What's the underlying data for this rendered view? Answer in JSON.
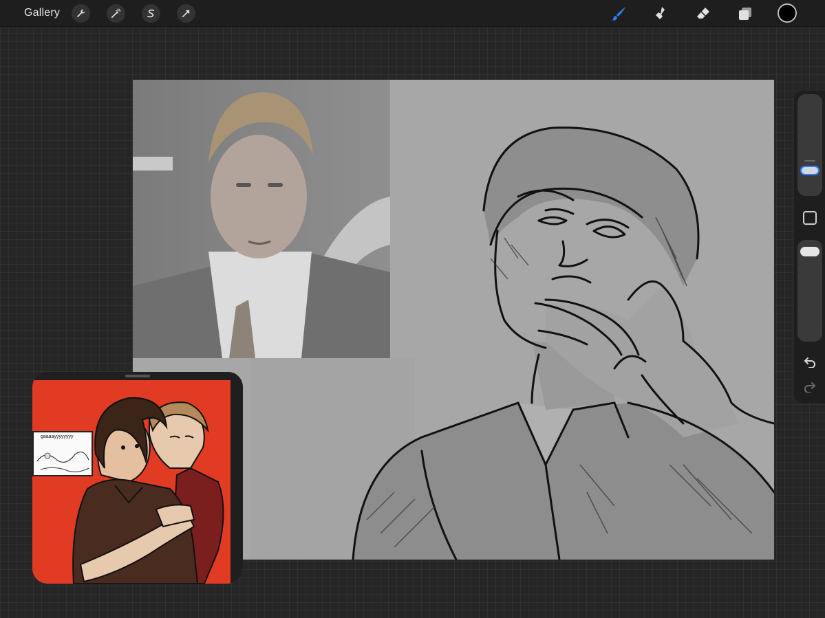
{
  "toolbar": {
    "gallery_label": "Gallery",
    "left_tools": [
      "wrench-icon",
      "magic-wand-icon",
      "selection-s-icon",
      "move-arrow-icon"
    ],
    "right_tools": [
      "brush-icon",
      "smudge-icon",
      "eraser-icon",
      "layers-icon"
    ],
    "active_tool": "brush-icon",
    "accent_color": "#2f7cf6",
    "current_color": "#000000"
  },
  "sidebar": {
    "brush_size_level": 0.75,
    "opacity_level": 1.0,
    "undo_icon": "undo-icon",
    "redo_icon": "redo-icon"
  },
  "reference_window": {
    "caption": "gaaaayyyyyyyy",
    "background_color": "#e23b23"
  }
}
